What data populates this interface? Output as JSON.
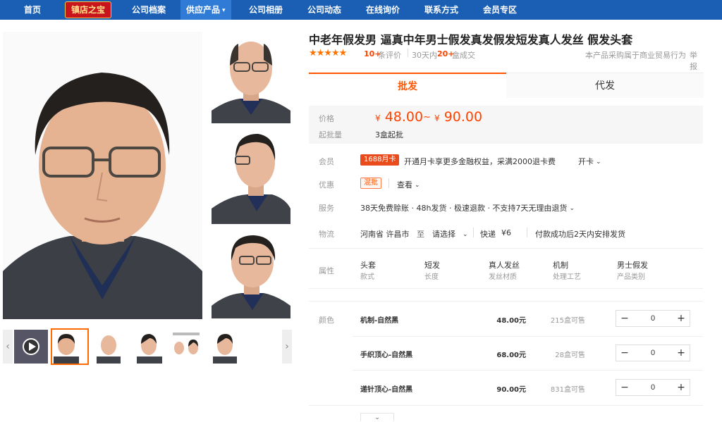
{
  "nav": {
    "home": "首页",
    "badge": "镇店之宝",
    "profile": "公司档案",
    "supply": "供应产品",
    "album": "公司相册",
    "news": "公司动态",
    "inquiry": "在线询价",
    "contact": "联系方式",
    "member": "会员专区"
  },
  "product": {
    "title": "中老年假发男 逼真中年男士假发真发假发短发真人发丝 假发头套",
    "rating_stars": 4.5,
    "review_count": "10+",
    "review_label": "条评价",
    "sales_period": "30天内",
    "sales_count": "20+",
    "sales_label": "盒成交",
    "trade_note": "本产品采购属于商业贸易行为",
    "report": "举报"
  },
  "tabs": {
    "wholesale": "批发",
    "dropship": "代发"
  },
  "pricing": {
    "price_label": "价格",
    "currency": "¥",
    "price_min": "48.00",
    "range_sep": "~",
    "price_max": "90.00",
    "moq_label": "起批量",
    "moq_value": "3盒起批"
  },
  "benefits": {
    "member_label": "会员",
    "card_tag": "1688月卡",
    "card_text": "开通月卡享更多金融权益，采满2000退卡费",
    "card_action": "开卡",
    "discount_label": "优惠",
    "mix_tag": "混批",
    "view": "查看",
    "service_label": "服务",
    "service_text": "38天免费赊账 · 48h发货 · 极速退款 · 不支持7天无理由退货",
    "logistics_label": "物流",
    "origin": "河南省 许昌市",
    "to": "至",
    "choose": "请选择",
    "express": "快递",
    "express_fee": "¥6",
    "ship_note": "付款成功后2天内安排发货"
  },
  "attributes": {
    "label": "属性",
    "items": [
      {
        "value": "头套",
        "key": "款式"
      },
      {
        "value": "短发",
        "key": "长度"
      },
      {
        "value": "真人发丝",
        "key": "发丝材质"
      },
      {
        "value": "机制",
        "key": "处理工艺"
      },
      {
        "value": "男士假发",
        "key": "产品类别"
      }
    ]
  },
  "skus": {
    "label": "颜色",
    "minus": "−",
    "plus": "+",
    "items": [
      {
        "name": "机制-自然黑",
        "price": "48.00元",
        "stock": "215盒可售",
        "qty": "0"
      },
      {
        "name": "手织顶心-自然黑",
        "price": "68.00元",
        "stock": "28盒可售",
        "qty": "0"
      },
      {
        "name": "递针顶心-自然黑",
        "price": "90.00元",
        "stock": "831盒可售",
        "qty": "0"
      }
    ]
  },
  "icons": [
    "chevron-down-icon",
    "star-icon",
    "play-icon",
    "arrow-left-icon",
    "arrow-right-icon"
  ],
  "colors": {
    "nav": "#1a5fb4",
    "accent": "#ff5500",
    "badge": "#c8141c"
  }
}
